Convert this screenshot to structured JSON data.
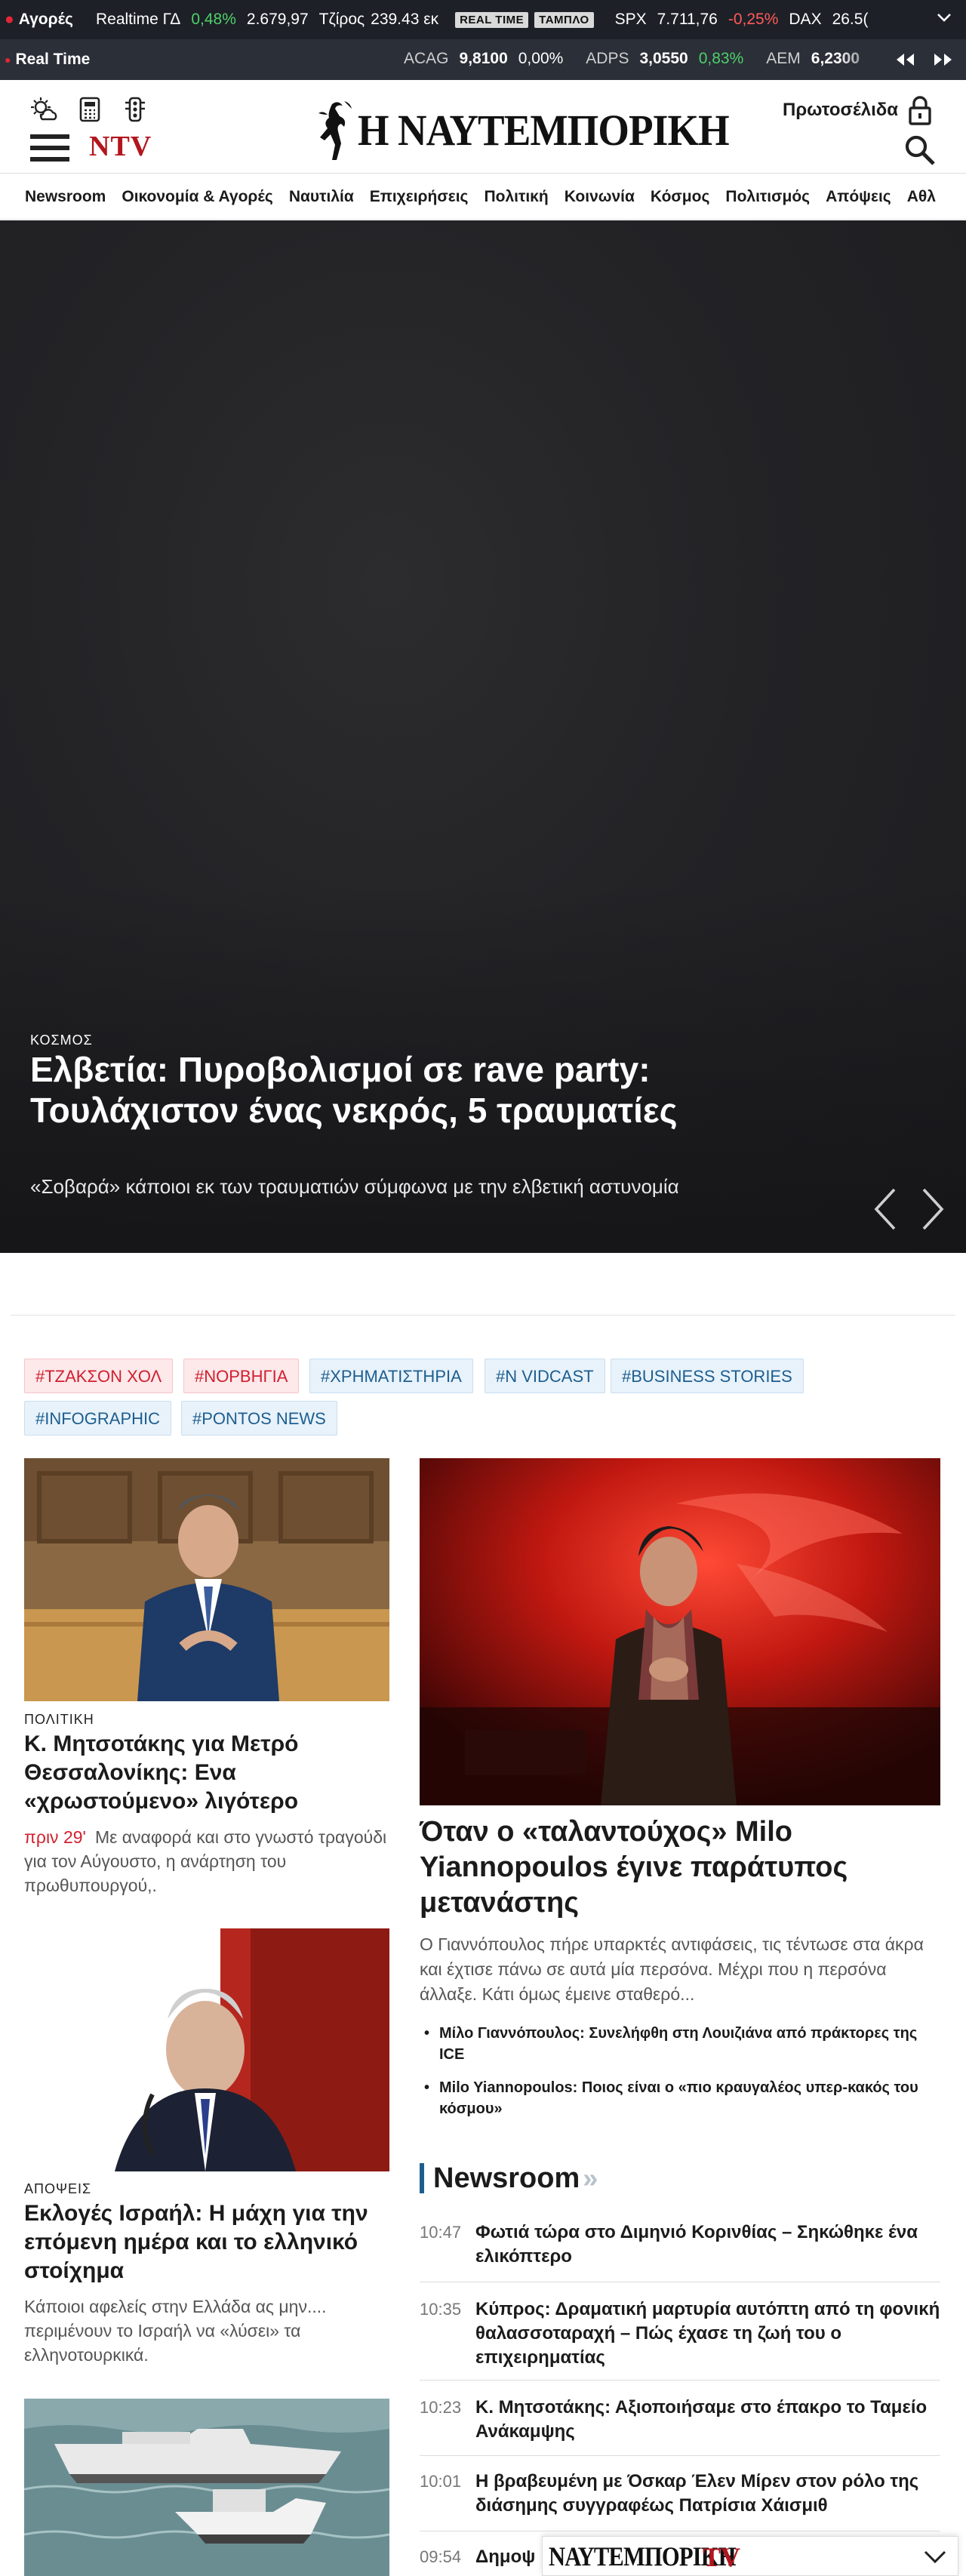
{
  "ticker": {
    "label": "Αγορές",
    "items": [
      {
        "name": "Realtime ΓΔ",
        "change": "0,48%",
        "value": "2.679,97"
      },
      {
        "name": "Τζίρος",
        "value": "239.43 εκ"
      }
    ],
    "badges": [
      "REAL TIME",
      "ΤΑΜΠΛΟ"
    ],
    "indices": [
      {
        "name": "SPX",
        "value": "7.711,76",
        "change": "-0,25%"
      },
      {
        "name": "DAX",
        "value": "26.5("
      }
    ]
  },
  "realtime": {
    "label": "Real Time",
    "stocks": [
      {
        "name": "ACAG",
        "value": "9,8100",
        "change": "0,00%"
      },
      {
        "name": "ADPS",
        "value": "3,0550",
        "change": "0,83%"
      },
      {
        "name": "AEM",
        "value": "6,2300"
      }
    ]
  },
  "header": {
    "logo": "Η ΝΑΥΤΕΜΠΟΡΙΚΗ",
    "ntv": "NTV",
    "frontpages": "Πρωτοσέλιδα"
  },
  "nav": [
    "Newsroom",
    "Οικονομία & Αγορές",
    "Ναυτιλία",
    "Επιχειρήσεις",
    "Πολιτική",
    "Κοινωνία",
    "Κόσμος",
    "Πολιτισμός",
    "Απόψεις",
    "Αθλ"
  ],
  "hero": {
    "category": "ΚΟΣΜΟΣ",
    "title": "Ελβετία: Πυροβολισμοί σε rave party: Τουλάχιστον ένας νεκρός, 5 τραυματίες",
    "subtitle": "«Σοβαρά» κάποιοι εκ των τραυματιών σύμφωνα με την ελβετική αστυνομία"
  },
  "tags": [
    "#ΤΖΑΚΣΟΝ ΧΟΛ",
    "#ΝΟΡΒΗΓΙΑ",
    "#ΧΡΗΜΑΤΙΣΤΗΡΙΑ",
    "#N VIDCAST",
    "#BUSINESS STORIES",
    "#INFOGRAPHIC",
    "#PONTOS NEWS"
  ],
  "article1": {
    "category": "ΠΟΛΙΤΙΚΗ",
    "title": "Κ. Μητσοτάκης για Μετρό Θεσσαλονίκης: Ενα «χρωστούμενο» λιγότερο",
    "time": "πριν 29'",
    "desc": "Με αναφορά και στο γνωστό τραγούδι για τον Αύγουστο, η ανάρτηση του πρωθυπουργού,."
  },
  "featured": {
    "title": "Όταν ο «ταλαντούχος» Milo Yiannopoulos έγινε παράτυπος μετανάστης",
    "desc": "Ο Γιαννόπουλος πήρε υπαρκτές αντιφάσεις, τις τέντωσε στα άκρα και έχτισε πάνω σε αυτά μία περσόνα. Μέχρι που η περσόνα άλλαξε. Κάτι όμως έμεινε σταθερό...",
    "related": [
      "Μίλο Γιαννόπουλος: Συνελήφθη στη Λουιζιάνα από πράκτορες της ICE",
      "Milo Yiannopoulos: Ποιος είναι ο «πιο κραυγαλέος υπερ-κακός του κόσμου»"
    ]
  },
  "article2": {
    "category": "ΑΠΟΨΕΙΣ",
    "title": "Εκλογές Ισραήλ: Η μάχη για την επόμενη ημέρα και το ελληνικό στοίχημα",
    "desc": "Κάποιοι αφελείς στην Ελλάδα ας μην.... περιμένουν το Ισραήλ να «λύσει» τα ελληνοτουρκικά."
  },
  "newsroom": {
    "heading": "Newsroom",
    "items": [
      {
        "time": "10:47",
        "title": "Φωτιά τώρα στο Διμηνιό Κορινθίας – Σηκώθηκε ένα ελικόπτερο"
      },
      {
        "time": "10:35",
        "title": "Κύπρος: Δραματική μαρτυρία αυτόπτη από τη φονική θαλασσοταραχή – Πώς έχασε τη ζωή του ο επιχειρηματίας"
      },
      {
        "time": "10:23",
        "title": "Κ. Μητσοτάκης: Αξιοποιήσαμε στο έπακρο το Ταμείο Ανάκαμψης"
      },
      {
        "time": "10:01",
        "title": "Η βραβευμένη με Όσκαρ Έλεν Μίρεν στον ρόλο της διάσημης συγγραφέως Πατρίσια Χάισμιθ"
      },
      {
        "time": "09:54",
        "title": "Δημοψ"
      }
    ]
  },
  "ntv_bar": {
    "label": "ΝΑΥΤΕΜΠΟΡΙΚΗ",
    "tv": "TV"
  }
}
